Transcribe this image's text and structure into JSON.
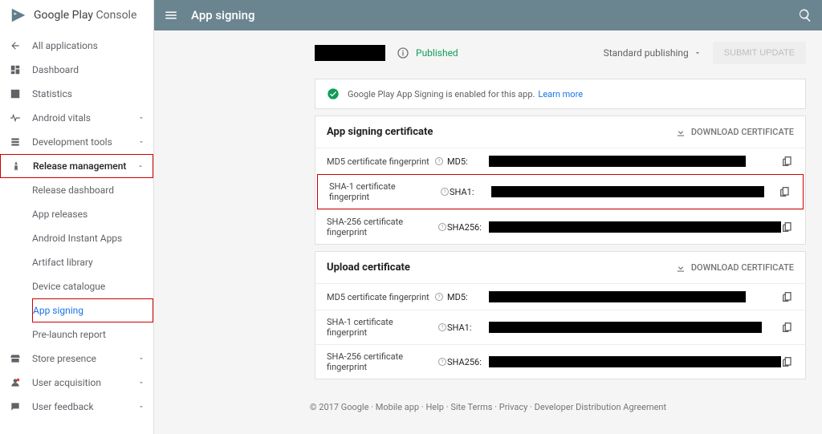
{
  "brand": {
    "text1": "Google Play",
    "text2": " Console"
  },
  "topbar": {
    "title": "App signing"
  },
  "nav": {
    "all_apps": "All applications",
    "dashboard": "Dashboard",
    "statistics": "Statistics",
    "vitals": "Android vitals",
    "dev_tools": "Development tools",
    "release_mgmt": "Release management",
    "release_dash": "Release dashboard",
    "app_releases": "App releases",
    "instant": "Android Instant Apps",
    "artifact": "Artifact library",
    "device_cat": "Device catalogue",
    "app_signing": "App signing",
    "prelaunch": "Pre-launch report",
    "store": "Store presence",
    "acquisition": "User acquisition",
    "feedback": "User feedback"
  },
  "header": {
    "status": "Published",
    "mode": "Standard publishing",
    "submit": "SUBMIT UPDATE"
  },
  "info": {
    "text": "Google Play App Signing is enabled for this app.",
    "link": "Learn more"
  },
  "certs": {
    "download": "DOWNLOAD CERTIFICATE",
    "signing_title": "App signing certificate",
    "upload_title": "Upload certificate",
    "md5_label": "MD5 certificate fingerprint",
    "sha1_label": "SHA-1 certificate fingerprint",
    "sha256_label": "SHA-256 certificate fingerprint",
    "md5_prefix": "MD5:",
    "sha1_prefix": "SHA1:",
    "sha256_prefix": "SHA256:"
  },
  "footer": {
    "copyright": "© 2017 Google",
    "links": [
      "Mobile app",
      "Help",
      "Site Terms",
      "Privacy",
      "Developer Distribution Agreement"
    ]
  }
}
